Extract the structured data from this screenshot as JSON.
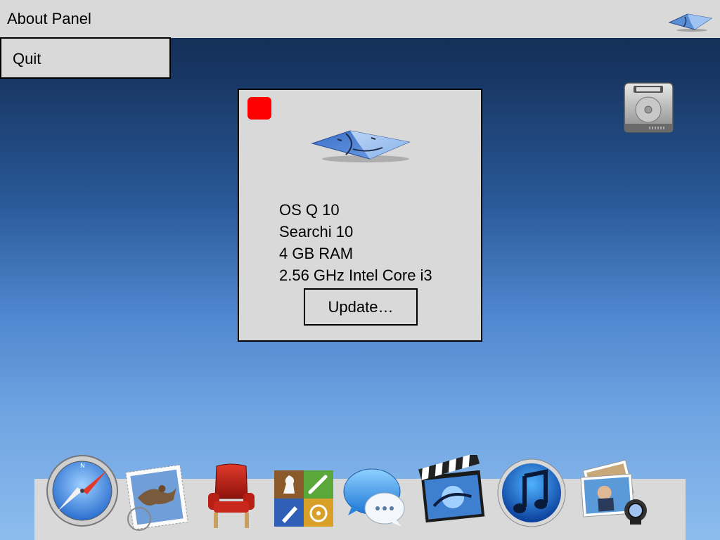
{
  "menubar": {
    "app_title": "About Panel",
    "right_icon": "finder-icon"
  },
  "menu": {
    "items": [
      {
        "label": "Quit"
      }
    ]
  },
  "desktop": {
    "icons": [
      "hard-drive-icon"
    ]
  },
  "about_panel": {
    "logo_icon": "finder-icon",
    "close_color": "#ff0000",
    "lines": [
      "OS Q 10",
      "Searchi 10",
      "4 GB RAM",
      "2.56 GHz Intel Core i3"
    ],
    "update_button_label": "Update…"
  },
  "dock": {
    "items": [
      {
        "name": "safari-icon"
      },
      {
        "name": "mail-icon"
      },
      {
        "name": "chair-icon"
      },
      {
        "name": "game-center-icon"
      },
      {
        "name": "messages-icon"
      },
      {
        "name": "imovie-icon"
      },
      {
        "name": "itunes-icon"
      },
      {
        "name": "iphoto-icon"
      }
    ]
  }
}
